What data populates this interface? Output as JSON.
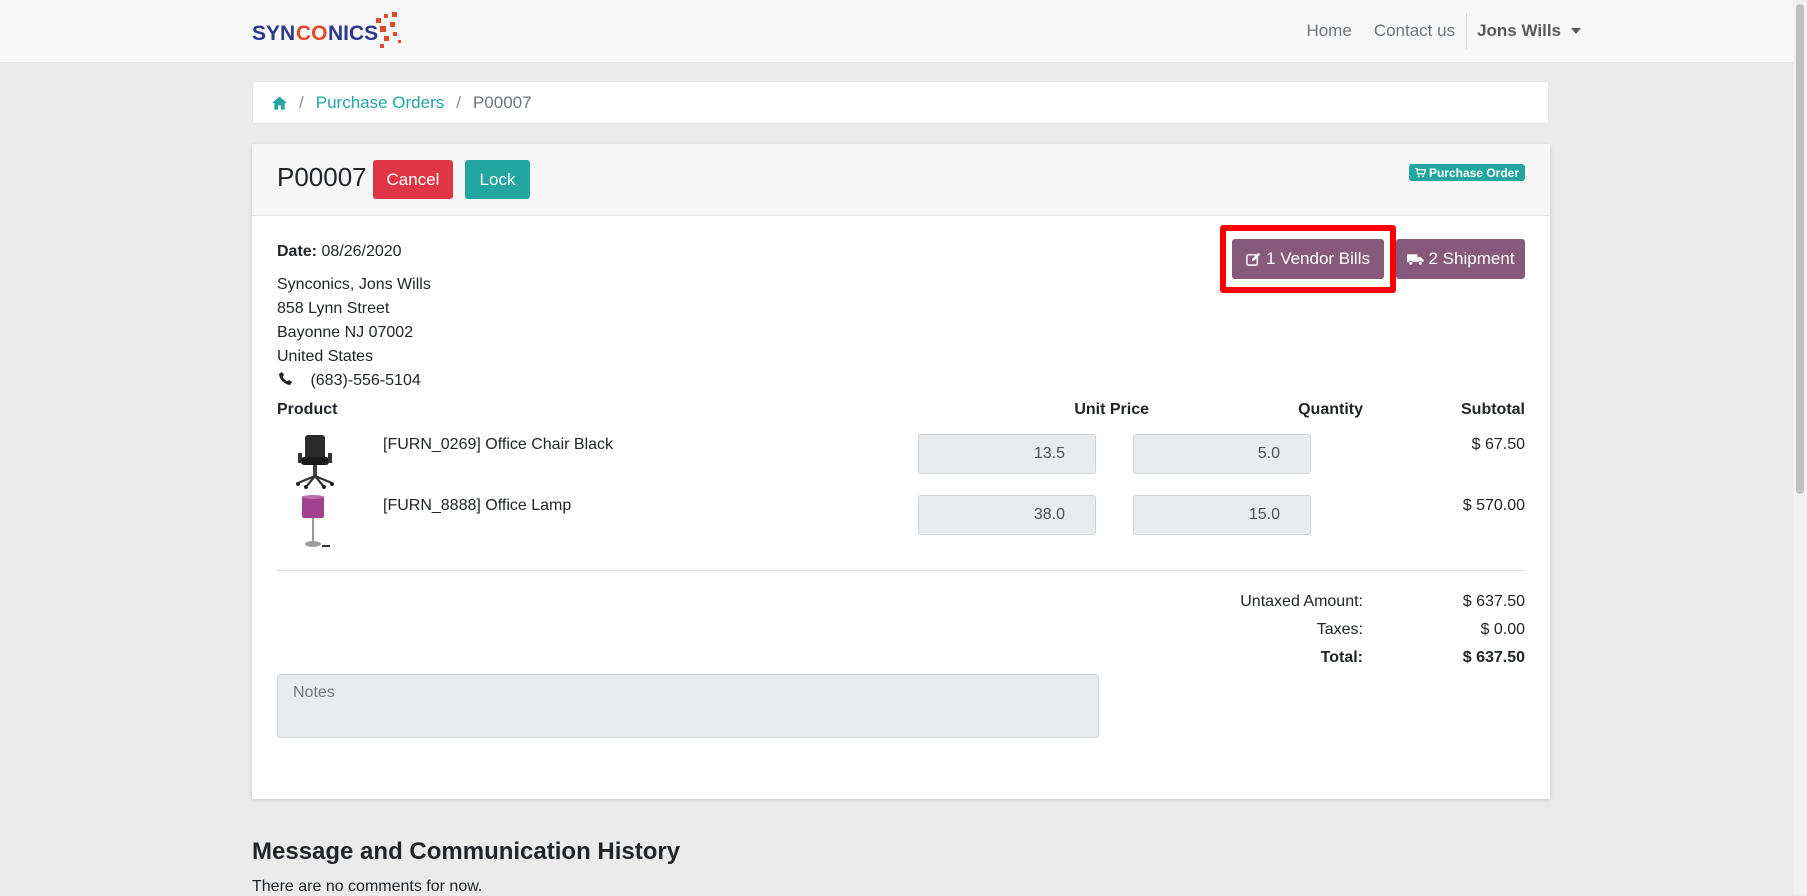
{
  "brand": {
    "name": "SYNCONICS"
  },
  "nav": {
    "home": "Home",
    "contact": "Contact us",
    "user": "Jons Wills"
  },
  "breadcrumb": {
    "home_icon": "home-icon",
    "purchase_orders": "Purchase Orders",
    "current": "P00007"
  },
  "order": {
    "title": "P00007",
    "cancel_label": "Cancel",
    "lock_label": "Lock",
    "badge": "Purchase Order",
    "vendor_bills": "1 Vendor Bills",
    "shipment": "2 Shipment",
    "date_label": "Date:",
    "date_value": "08/26/2020",
    "address": [
      "Synconics, Jons Wills",
      "858 Lynn Street",
      "Bayonne NJ 07002",
      "United States"
    ],
    "phone": "(683)-556-5104"
  },
  "table": {
    "headers": {
      "product": "Product",
      "unit_price": "Unit Price",
      "quantity": "Quantity",
      "subtotal": "Subtotal"
    },
    "rows": [
      {
        "name": "[FURN_0269] Office Chair Black",
        "unit_price": "13.5",
        "quantity": "5.0",
        "subtotal": "$ 67.50",
        "image": "office-chair"
      },
      {
        "name": "[FURN_8888] Office Lamp",
        "unit_price": "38.0",
        "quantity": "15.0",
        "subtotal": "$ 570.00",
        "image": "office-lamp"
      }
    ]
  },
  "totals": {
    "untaxed_label": "Untaxed Amount:",
    "untaxed_value": "$ 637.50",
    "taxes_label": "Taxes:",
    "taxes_value": "$ 0.00",
    "total_label": "Total:",
    "total_value": "$ 637.50"
  },
  "notes": {
    "placeholder": "Notes"
  },
  "history": {
    "title": "Message and Communication History",
    "empty": "There are no comments for now."
  },
  "colors": {
    "accent": "#23a5a0",
    "danger": "#e03545",
    "purple": "#875a7b",
    "highlight": "#ff0000"
  }
}
